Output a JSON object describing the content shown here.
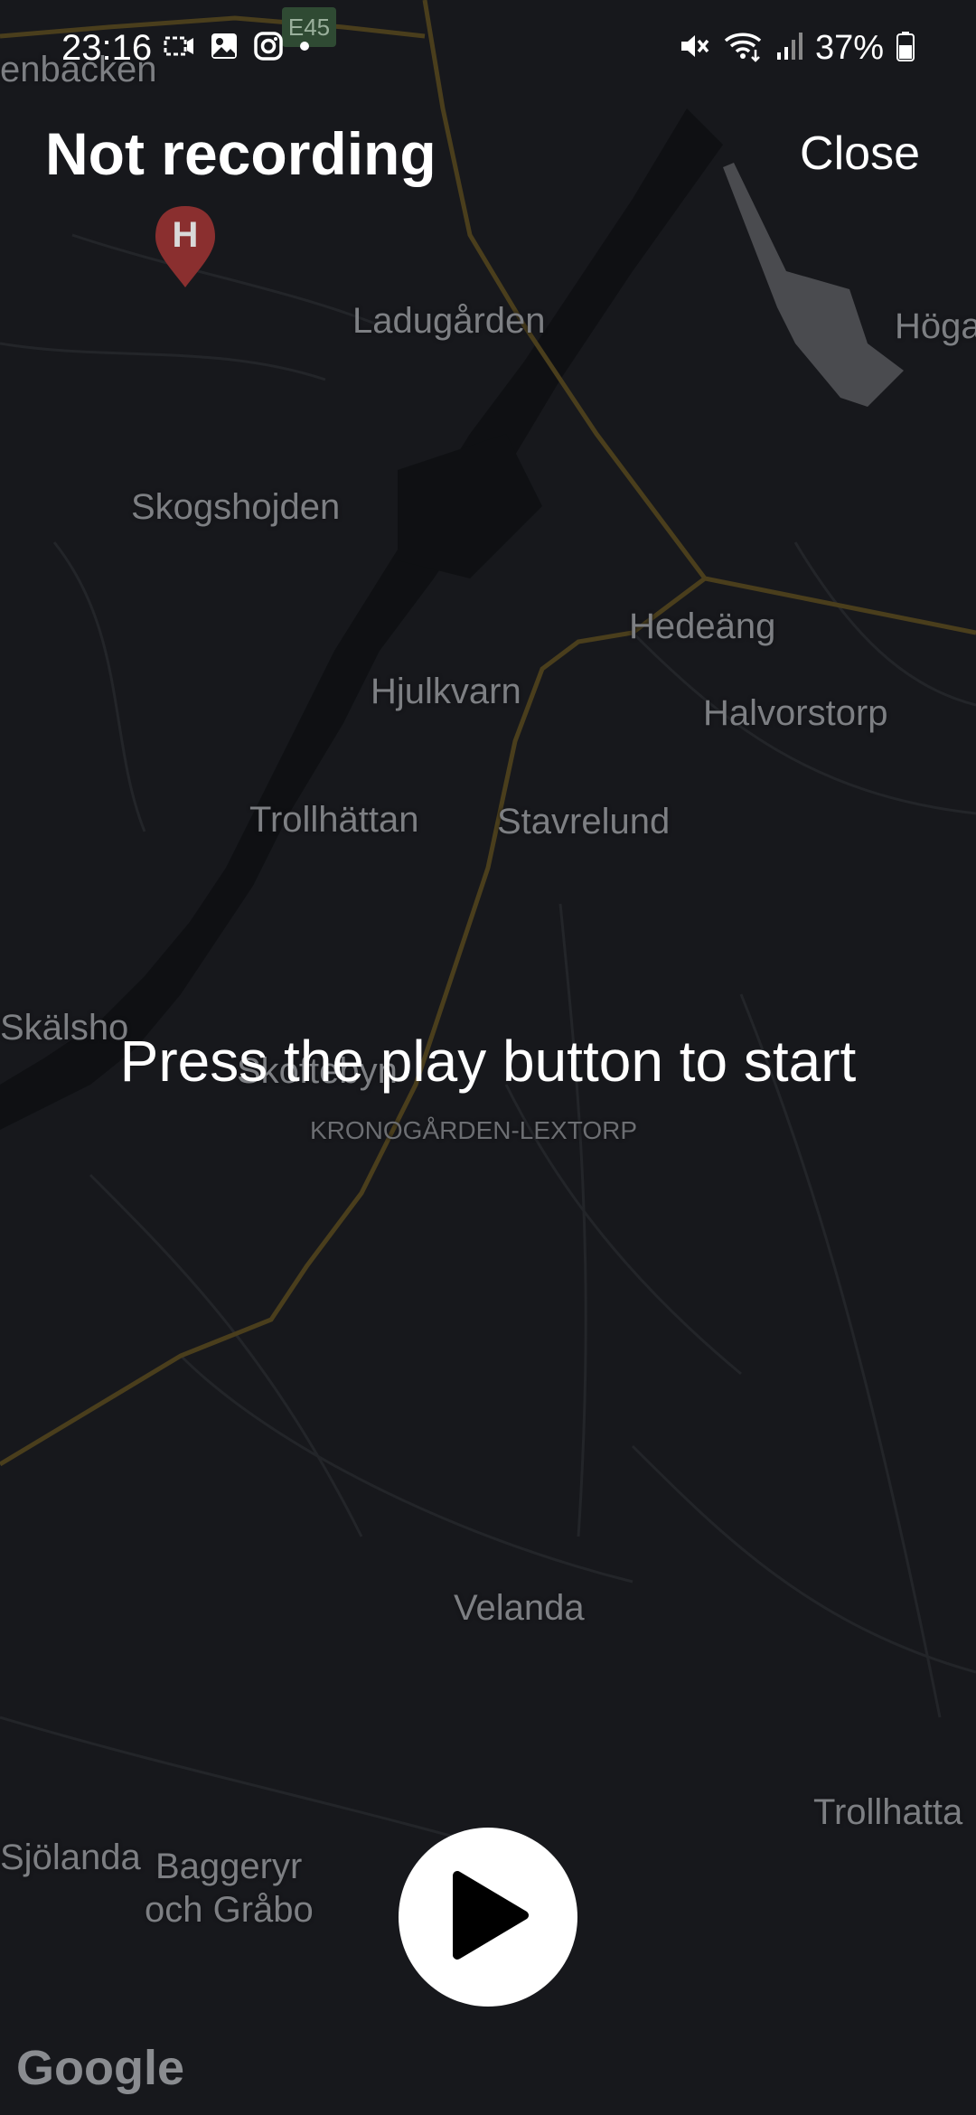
{
  "status_bar": {
    "time": "23:16",
    "left_icons": [
      "screen-record-icon",
      "gallery-icon",
      "instagram-icon",
      "dot-icon"
    ],
    "right_icons": [
      "mute-icon",
      "wifi-icon",
      "signal-icon",
      "battery-icon"
    ],
    "battery": "37%"
  },
  "header": {
    "title": "Not recording",
    "close_label": "Close"
  },
  "main": {
    "prompt": "Press the play button to start",
    "play_button_icon": "play-icon"
  },
  "map": {
    "attribution": "Google",
    "road_badge": "E45",
    "marker_icon": "hospital-marker-icon",
    "marker_letter": "H",
    "labels": {
      "enbacken": "enbacken",
      "ladugarden": "Ladugården",
      "hoga": "Höga",
      "skogshojden": "Skogshojden",
      "hedeang": "Hedeäng",
      "hjulkvarn": "Hjulkvarn",
      "halvorstorp": "Halvorstorp",
      "trollhattan": "Trollhättan",
      "stavrelund": "Stavrelund",
      "skalsho": "Skälsho",
      "skoftebyn": "Skoftebyn",
      "kronogarden": "KRONOGÅRDEN-LEXTORP",
      "velanda": "Velanda",
      "trollhatta2": "Trollhatta",
      "sjolanda": "Sjölanda",
      "baggeryr": "Baggeryr",
      "och_grabo": "och Gråbo"
    }
  },
  "colors": {
    "background": "#17181c",
    "road": "#5a4a1e",
    "water": "#0e0f12",
    "text": "#ffffff",
    "map_label": "#7d7f83",
    "marker": "#8a2f2f"
  }
}
